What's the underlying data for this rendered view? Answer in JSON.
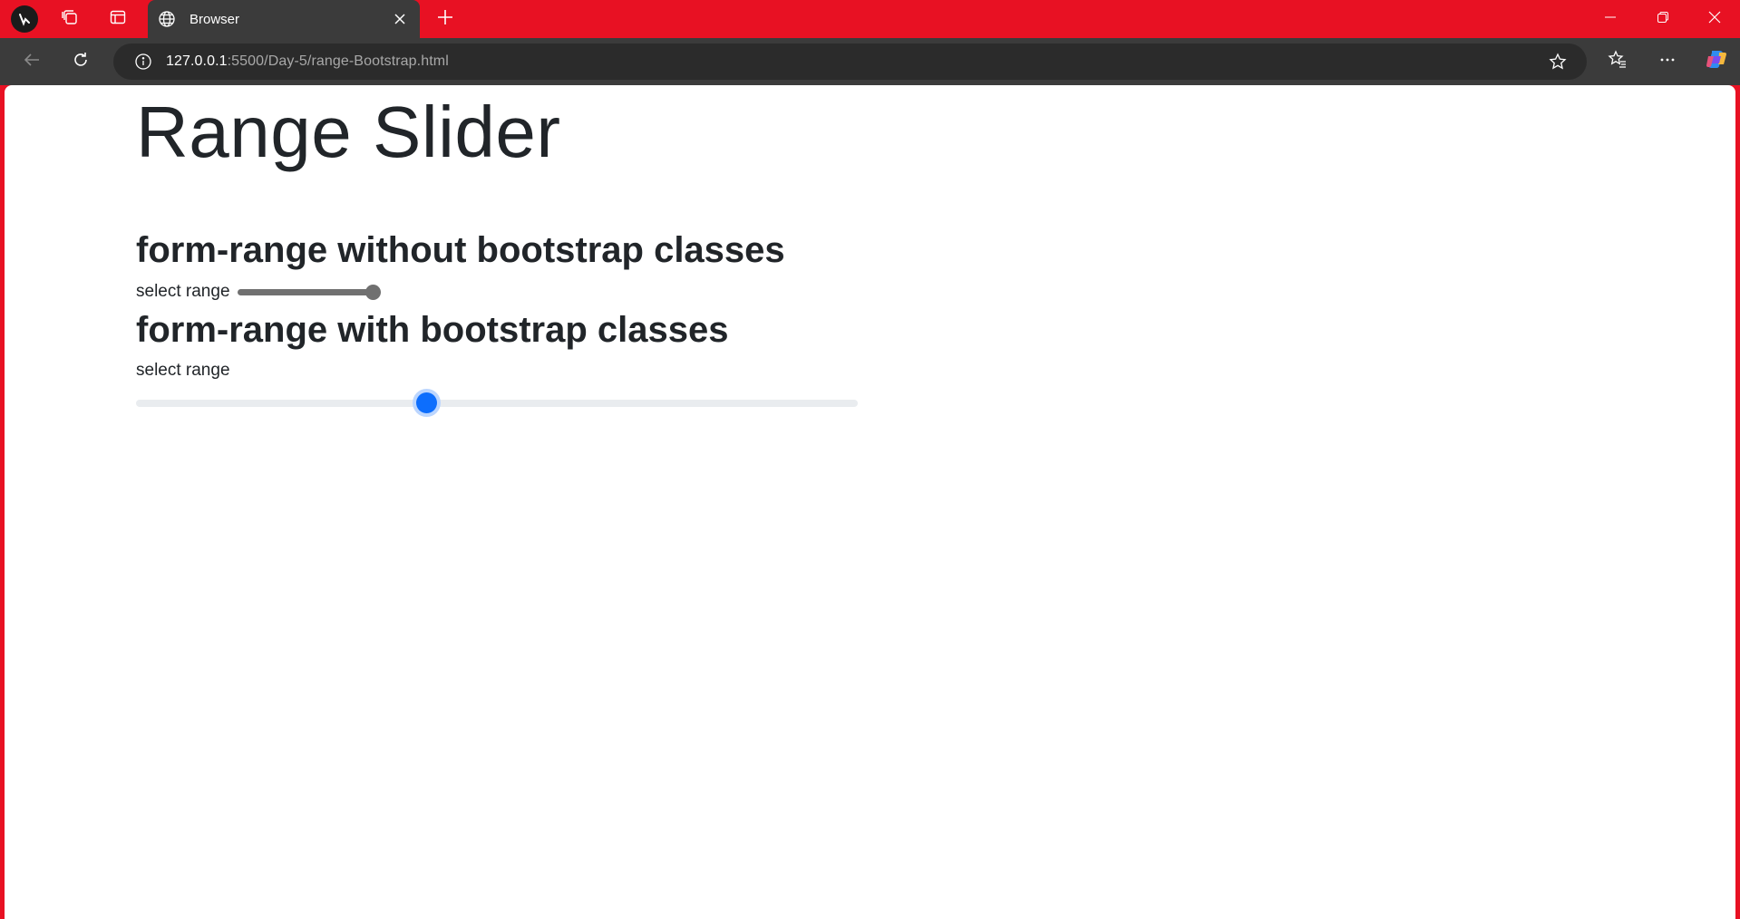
{
  "browser": {
    "tab": {
      "title": "Browser"
    },
    "address": {
      "host": "127.0.0.1",
      "path": ":5500/Day-5/range-Bootstrap.html"
    }
  },
  "page": {
    "title": "Range Slider",
    "section_one": {
      "heading": "form-range without bootstrap classes",
      "label": "select range",
      "value": 100
    },
    "section_two": {
      "heading": "form-range with bootstrap classes",
      "label": "select range",
      "value": 40
    }
  },
  "colors": {
    "title_bar": "#e81123",
    "toolbar": "#3b3b3b",
    "bootstrap_primary": "#0d6efd",
    "native_slider": "#707070"
  },
  "icons": [
    "profile-icon",
    "workspaces-icon",
    "vertical-tabs-icon",
    "globe-icon",
    "close-icon",
    "plus-icon",
    "minimize-icon",
    "restore-icon",
    "back-icon",
    "reload-icon",
    "info-icon",
    "star-icon",
    "favorites-icon",
    "more-icon",
    "copilot-icon"
  ]
}
